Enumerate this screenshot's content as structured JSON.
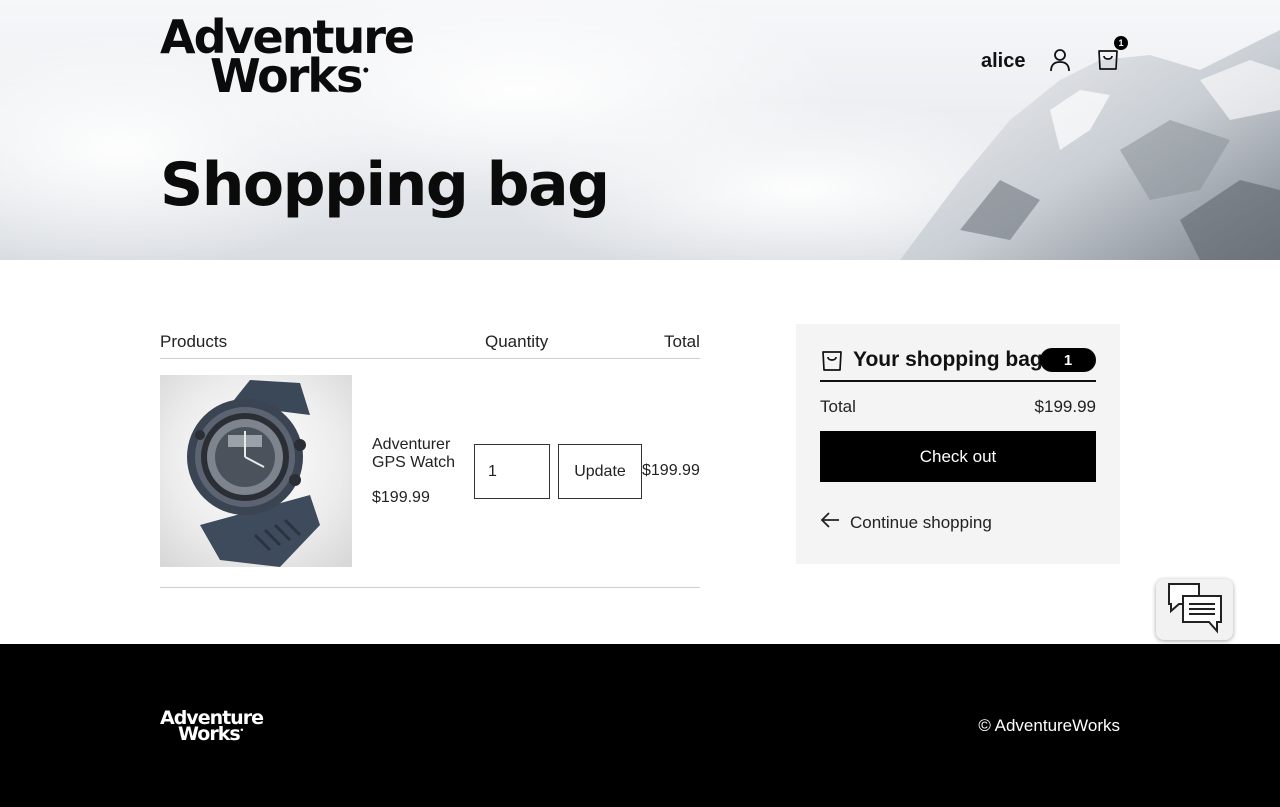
{
  "brand": {
    "line1": "Adventure",
    "line2": "Works",
    "reg_mark": "•"
  },
  "header": {
    "username": "alice",
    "cart_count": "1"
  },
  "page": {
    "title": "Shopping bag"
  },
  "table": {
    "headers": {
      "products": "Products",
      "quantity": "Quantity",
      "total": "Total"
    },
    "items": [
      {
        "name": "Adventurer GPS Watch",
        "price": "$199.99",
        "quantity": "1",
        "update_label": "Update",
        "line_total": "$199.99"
      }
    ]
  },
  "summary": {
    "title": "Your shopping bag",
    "count": "1",
    "total_label": "Total",
    "total_value": "$199.99",
    "checkout_label": "Check out",
    "continue_label": "Continue shopping"
  },
  "footer": {
    "copyright": "© AdventureWorks"
  },
  "colors": {
    "accent": "#000000",
    "summary_bg": "#f4f4f4",
    "footer_bg": "#000000"
  }
}
